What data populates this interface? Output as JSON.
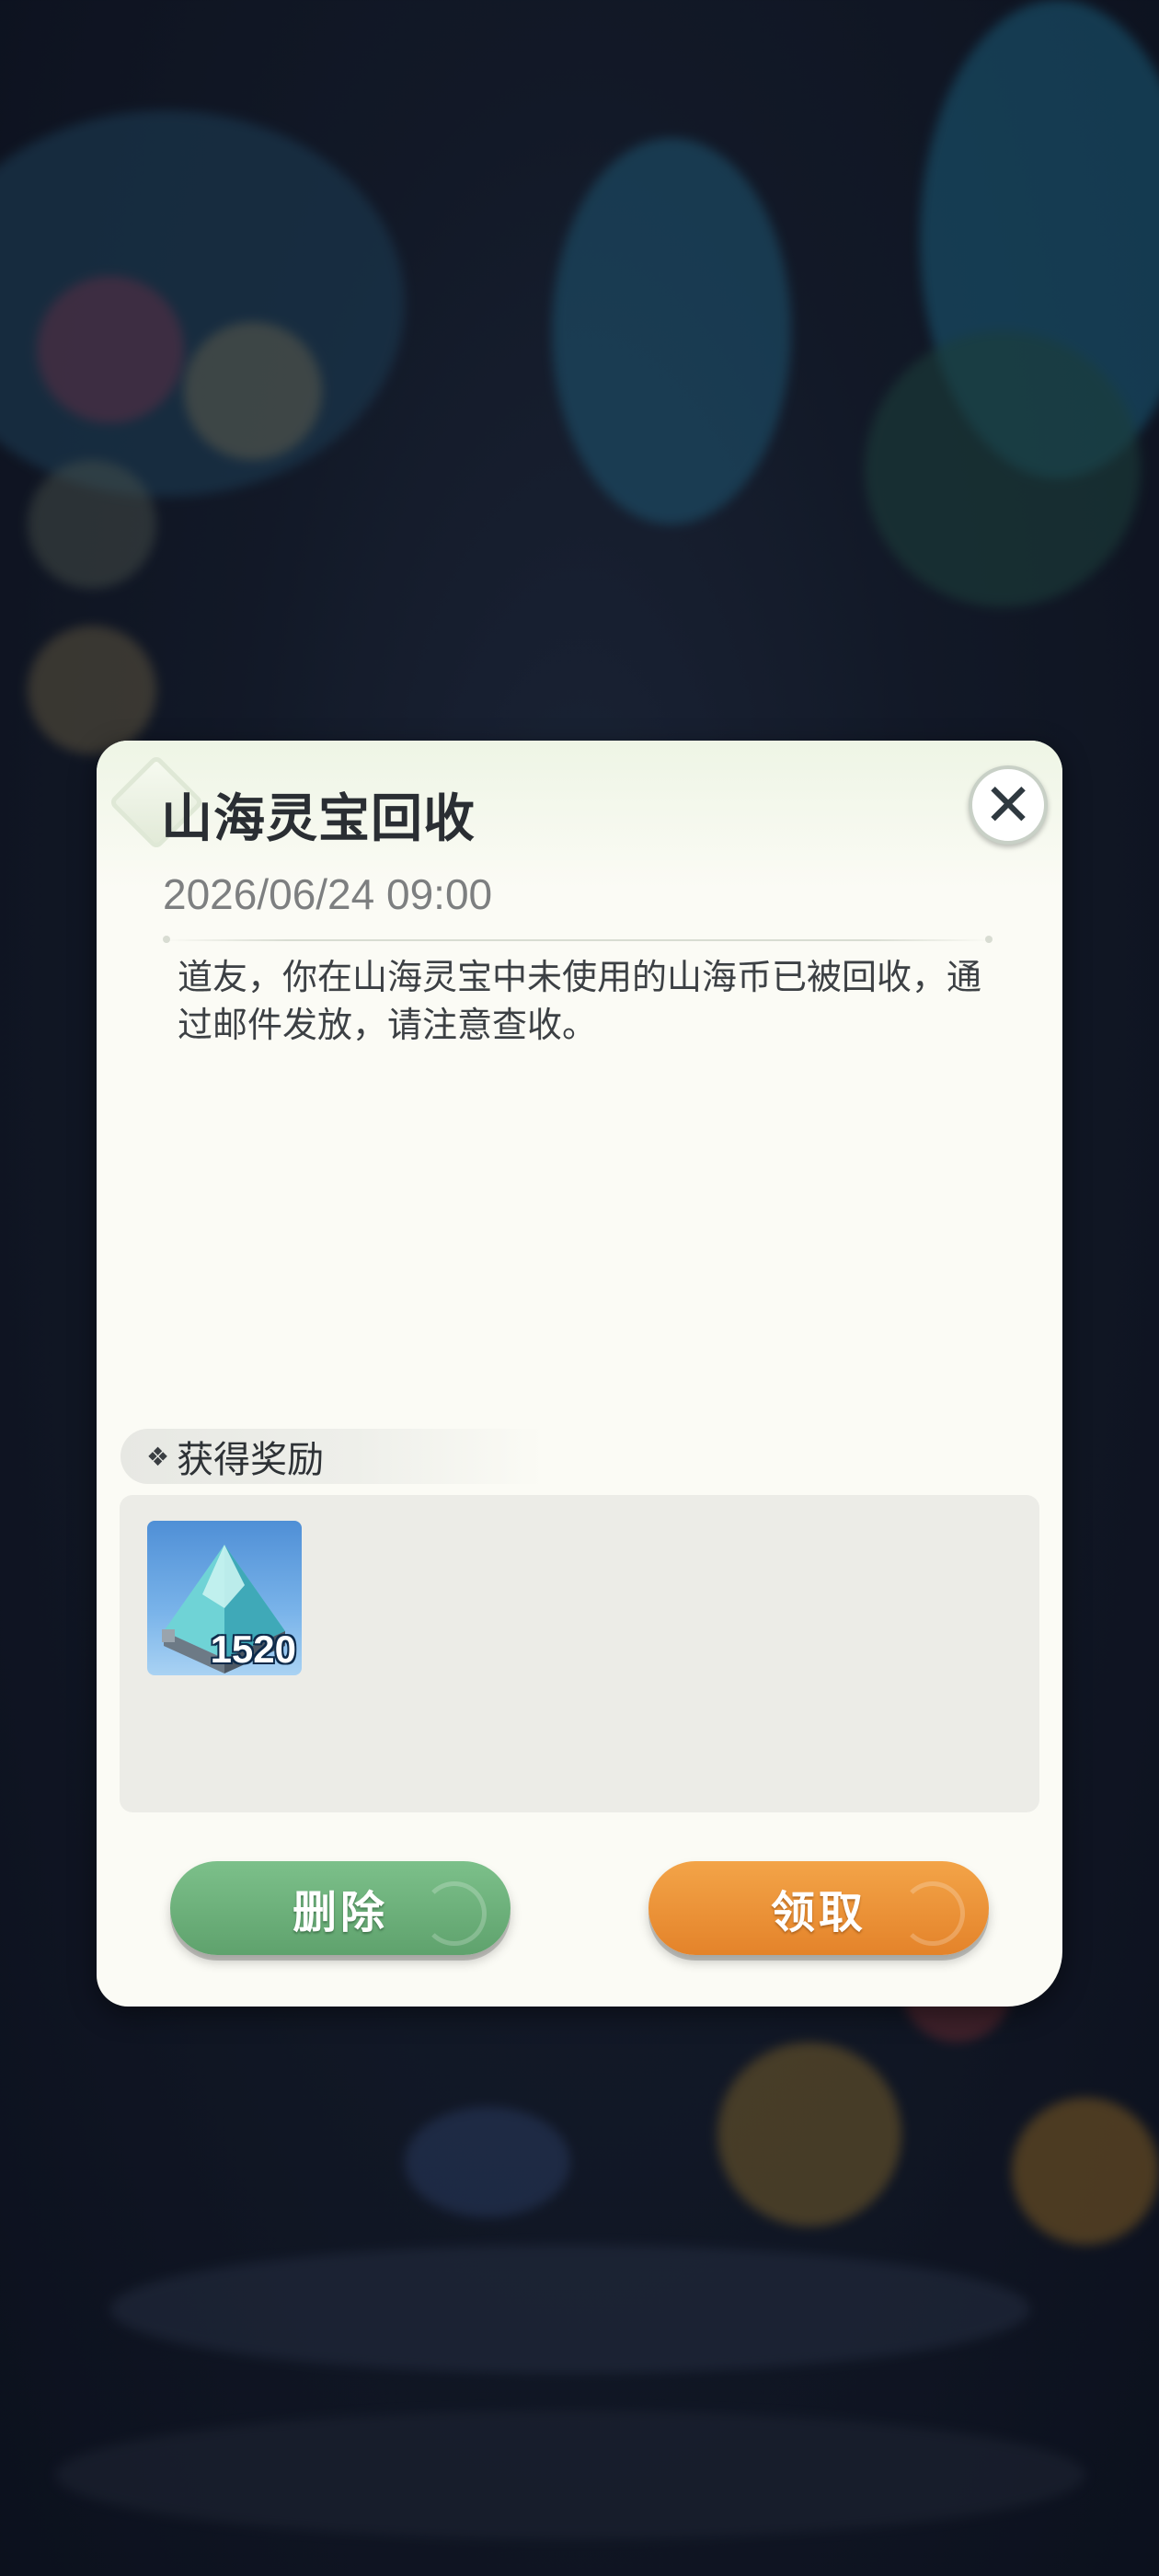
{
  "mail": {
    "title": "山海灵宝回收",
    "date": "2026/06/24 09:00",
    "body": "道友，你在山海灵宝中未使用的山海币已被回收，通过邮件发放，请注意查收。",
    "close_icon": "✕"
  },
  "reward": {
    "label": "获得奖励",
    "mark": "❖",
    "items": [
      {
        "icon": "ice-mountain-chest-icon",
        "quantity": "1520"
      }
    ]
  },
  "buttons": {
    "delete_label": "删除",
    "claim_label": "领取"
  },
  "colors": {
    "delete_button": "#6aae78",
    "claim_button": "#ec9338",
    "panel": "#fbfbf5"
  }
}
